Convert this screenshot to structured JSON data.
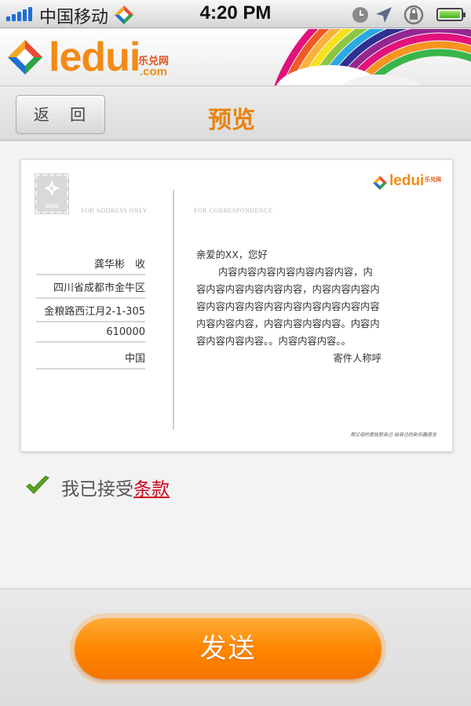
{
  "status_bar": {
    "carrier": "中国移动",
    "time": "4:20 PM",
    "signal_bars": 5,
    "battery_level": 1.0,
    "icons": [
      "signal-icon",
      "carrier-logo-icon",
      "alarm-icon",
      "location-arrow-icon",
      "rotation-lock-icon",
      "battery-icon"
    ]
  },
  "brand": {
    "logo_text": "ledui",
    "logo_sub": "乐兑网",
    "logo_com": ".com"
  },
  "nav": {
    "back_label": "返 回",
    "title": "预览"
  },
  "postcard": {
    "stamp_label": "ledui",
    "address_header": "FOR ADDRESS ONLY",
    "correspondence_header": "FOR CORRESPONDENCE",
    "card_logo_text": "ledui",
    "card_logo_sub": "乐兑网",
    "address_lines": [
      "龚华彬　收",
      "四川省成都市金牛区",
      "金粮路西江月2-1-305",
      "610000",
      "中国"
    ],
    "greeting": "亲爱的XX，您好",
    "body": "内容内容内容内容内容内容内容，内容内容内容内容内容内容，内容内容内容内容内容内容内容内容内容内容内容内容内容内容内容内容，内容内容内容内容。内容内容内容内容内容。。内容内容内容。。",
    "signature": "寄件人称呼",
    "footer_note": "用父母的爱抚慰自己 给自己的新乐趣感言"
  },
  "terms": {
    "prefix": "我已接受",
    "link": "条款",
    "checked": true
  },
  "send_label": "发送",
  "colors": {
    "accent_orange": "#ff8700",
    "title_orange": "#e8820d",
    "link_red": "#d0021b",
    "check_green": "#5aa51e"
  }
}
